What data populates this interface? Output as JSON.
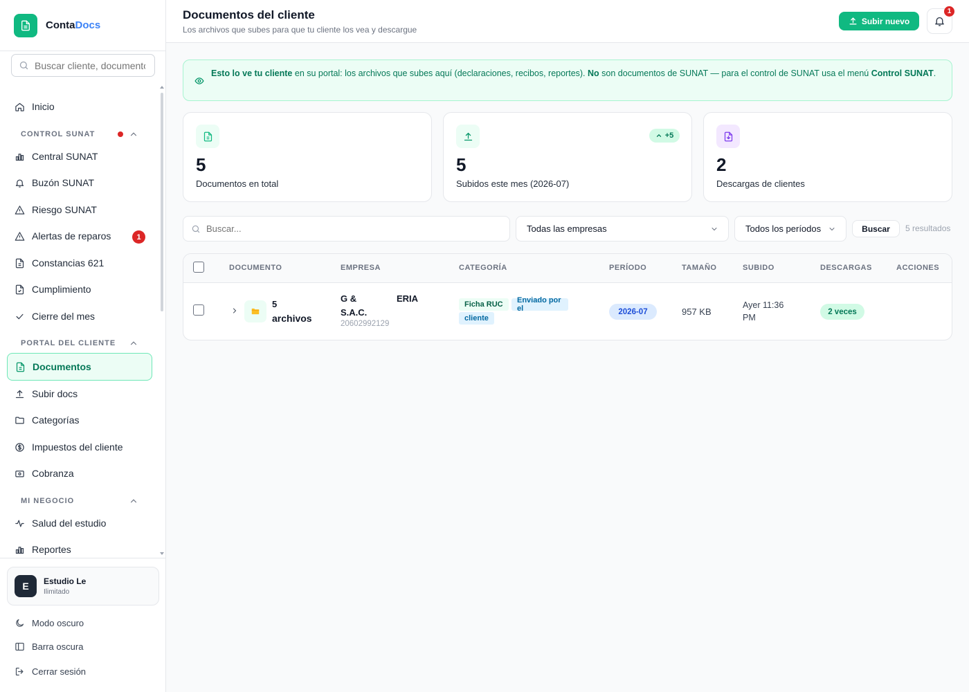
{
  "app": {
    "name_part1": "Conta",
    "name_part2": "Docs"
  },
  "sidebar": {
    "search_placeholder": "Buscar cliente, documento...",
    "home": "Inicio",
    "sections": [
      {
        "label": "CONTROL SUNAT",
        "items": [
          "Central SUNAT",
          "Buzón SUNAT",
          "Riesgo SUNAT",
          "Alertas de reparos",
          "Constancias 621",
          "Cumplimiento",
          "Cierre del mes"
        ]
      },
      {
        "label": "PORTAL DEL CLIENTE",
        "items": [
          "Documentos",
          "Subir docs",
          "Categorías",
          "Impuestos del cliente",
          "Cobranza"
        ]
      },
      {
        "label": "MI NEGOCIO",
        "items": [
          "Salud del estudio",
          "Reportes"
        ]
      }
    ],
    "alerts_badge": "1",
    "active_item": "Documentos",
    "account": {
      "initial": "E",
      "name": "Estudio Le",
      "plan": "Ilimitado"
    },
    "bottom": [
      "Modo oscuro",
      "Barra oscura",
      "Cerrar sesión"
    ]
  },
  "header": {
    "title": "Documentos del cliente",
    "subtitle": "Los archivos que subes para que tu cliente los vea y descargue",
    "upload_button": "Subir nuevo",
    "notif_count": "1"
  },
  "banner": {
    "p1": "Esto lo ve tu cliente",
    "p2": " en su portal: los archivos que subes aquí (declaraciones, recibos, reportes). ",
    "p3": "No",
    "p4": " son documentos de SUNAT — para el control de SUNAT usa el menú ",
    "p5": "Control SUNAT",
    "p6": "."
  },
  "stats": [
    {
      "value": "5",
      "label": "Documentos en total",
      "icon": "document-icon",
      "color": "#10b981"
    },
    {
      "value": "5",
      "label": "Subidos este mes (2026-07)",
      "icon": "upload-icon",
      "color": "#059669",
      "trend": "+5"
    },
    {
      "value": "2",
      "label": "Descargas de clientes",
      "icon": "download-file-icon",
      "color": "#7c3aed"
    }
  ],
  "filters": {
    "search_placeholder": "Buscar...",
    "company": "Todas las empresas",
    "period": "Todos los períodos",
    "button": "Buscar",
    "results": "5 resultados"
  },
  "table": {
    "columns": [
      "DOCUMENTO",
      "EMPRESA",
      "CATEGORÍA",
      "PERÍODO",
      "TAMAÑO",
      "SUBIDO",
      "DESCARGAS",
      "ACCIONES"
    ],
    "rows": [
      {
        "doc_count": "5",
        "doc_word": "archivos",
        "company_line1": "G &",
        "company_line1b": "ERIA",
        "company_line2": "S.A.C.",
        "ruc": "20602992129",
        "tag1": "Ficha RUC",
        "tag2a": "Enviado por el",
        "tag2b": "cliente",
        "period": "2026-07",
        "size": "957 KB",
        "uploaded_line1": "Ayer 11:36",
        "uploaded_line2": "PM",
        "downloads": "2 veces"
      }
    ]
  },
  "colors": {
    "accent": "#10b981",
    "brand_blue": "#3b82f6",
    "danger": "#dc2626"
  }
}
